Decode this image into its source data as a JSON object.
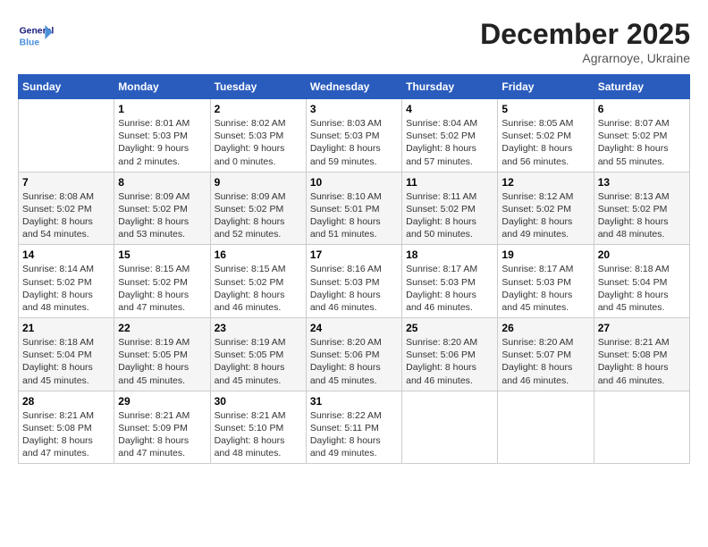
{
  "logo": {
    "line1": "General",
    "line2": "Blue"
  },
  "title": "December 2025",
  "subtitle": "Agrarnoye, Ukraine",
  "days_of_week": [
    "Sunday",
    "Monday",
    "Tuesday",
    "Wednesday",
    "Thursday",
    "Friday",
    "Saturday"
  ],
  "weeks": [
    [
      {
        "day": "",
        "text": ""
      },
      {
        "day": "1",
        "text": "Sunrise: 8:01 AM\nSunset: 5:03 PM\nDaylight: 9 hours\nand 2 minutes."
      },
      {
        "day": "2",
        "text": "Sunrise: 8:02 AM\nSunset: 5:03 PM\nDaylight: 9 hours\nand 0 minutes."
      },
      {
        "day": "3",
        "text": "Sunrise: 8:03 AM\nSunset: 5:03 PM\nDaylight: 8 hours\nand 59 minutes."
      },
      {
        "day": "4",
        "text": "Sunrise: 8:04 AM\nSunset: 5:02 PM\nDaylight: 8 hours\nand 57 minutes."
      },
      {
        "day": "5",
        "text": "Sunrise: 8:05 AM\nSunset: 5:02 PM\nDaylight: 8 hours\nand 56 minutes."
      },
      {
        "day": "6",
        "text": "Sunrise: 8:07 AM\nSunset: 5:02 PM\nDaylight: 8 hours\nand 55 minutes."
      }
    ],
    [
      {
        "day": "7",
        "text": "Sunrise: 8:08 AM\nSunset: 5:02 PM\nDaylight: 8 hours\nand 54 minutes."
      },
      {
        "day": "8",
        "text": "Sunrise: 8:09 AM\nSunset: 5:02 PM\nDaylight: 8 hours\nand 53 minutes."
      },
      {
        "day": "9",
        "text": "Sunrise: 8:09 AM\nSunset: 5:02 PM\nDaylight: 8 hours\nand 52 minutes."
      },
      {
        "day": "10",
        "text": "Sunrise: 8:10 AM\nSunset: 5:01 PM\nDaylight: 8 hours\nand 51 minutes."
      },
      {
        "day": "11",
        "text": "Sunrise: 8:11 AM\nSunset: 5:02 PM\nDaylight: 8 hours\nand 50 minutes."
      },
      {
        "day": "12",
        "text": "Sunrise: 8:12 AM\nSunset: 5:02 PM\nDaylight: 8 hours\nand 49 minutes."
      },
      {
        "day": "13",
        "text": "Sunrise: 8:13 AM\nSunset: 5:02 PM\nDaylight: 8 hours\nand 48 minutes."
      }
    ],
    [
      {
        "day": "14",
        "text": "Sunrise: 8:14 AM\nSunset: 5:02 PM\nDaylight: 8 hours\nand 48 minutes."
      },
      {
        "day": "15",
        "text": "Sunrise: 8:15 AM\nSunset: 5:02 PM\nDaylight: 8 hours\nand 47 minutes."
      },
      {
        "day": "16",
        "text": "Sunrise: 8:15 AM\nSunset: 5:02 PM\nDaylight: 8 hours\nand 46 minutes."
      },
      {
        "day": "17",
        "text": "Sunrise: 8:16 AM\nSunset: 5:03 PM\nDaylight: 8 hours\nand 46 minutes."
      },
      {
        "day": "18",
        "text": "Sunrise: 8:17 AM\nSunset: 5:03 PM\nDaylight: 8 hours\nand 46 minutes."
      },
      {
        "day": "19",
        "text": "Sunrise: 8:17 AM\nSunset: 5:03 PM\nDaylight: 8 hours\nand 45 minutes."
      },
      {
        "day": "20",
        "text": "Sunrise: 8:18 AM\nSunset: 5:04 PM\nDaylight: 8 hours\nand 45 minutes."
      }
    ],
    [
      {
        "day": "21",
        "text": "Sunrise: 8:18 AM\nSunset: 5:04 PM\nDaylight: 8 hours\nand 45 minutes."
      },
      {
        "day": "22",
        "text": "Sunrise: 8:19 AM\nSunset: 5:05 PM\nDaylight: 8 hours\nand 45 minutes."
      },
      {
        "day": "23",
        "text": "Sunrise: 8:19 AM\nSunset: 5:05 PM\nDaylight: 8 hours\nand 45 minutes."
      },
      {
        "day": "24",
        "text": "Sunrise: 8:20 AM\nSunset: 5:06 PM\nDaylight: 8 hours\nand 45 minutes."
      },
      {
        "day": "25",
        "text": "Sunrise: 8:20 AM\nSunset: 5:06 PM\nDaylight: 8 hours\nand 46 minutes."
      },
      {
        "day": "26",
        "text": "Sunrise: 8:20 AM\nSunset: 5:07 PM\nDaylight: 8 hours\nand 46 minutes."
      },
      {
        "day": "27",
        "text": "Sunrise: 8:21 AM\nSunset: 5:08 PM\nDaylight: 8 hours\nand 46 minutes."
      }
    ],
    [
      {
        "day": "28",
        "text": "Sunrise: 8:21 AM\nSunset: 5:08 PM\nDaylight: 8 hours\nand 47 minutes."
      },
      {
        "day": "29",
        "text": "Sunrise: 8:21 AM\nSunset: 5:09 PM\nDaylight: 8 hours\nand 47 minutes."
      },
      {
        "day": "30",
        "text": "Sunrise: 8:21 AM\nSunset: 5:10 PM\nDaylight: 8 hours\nand 48 minutes."
      },
      {
        "day": "31",
        "text": "Sunrise: 8:22 AM\nSunset: 5:11 PM\nDaylight: 8 hours\nand 49 minutes."
      },
      {
        "day": "",
        "text": ""
      },
      {
        "day": "",
        "text": ""
      },
      {
        "day": "",
        "text": ""
      }
    ]
  ]
}
